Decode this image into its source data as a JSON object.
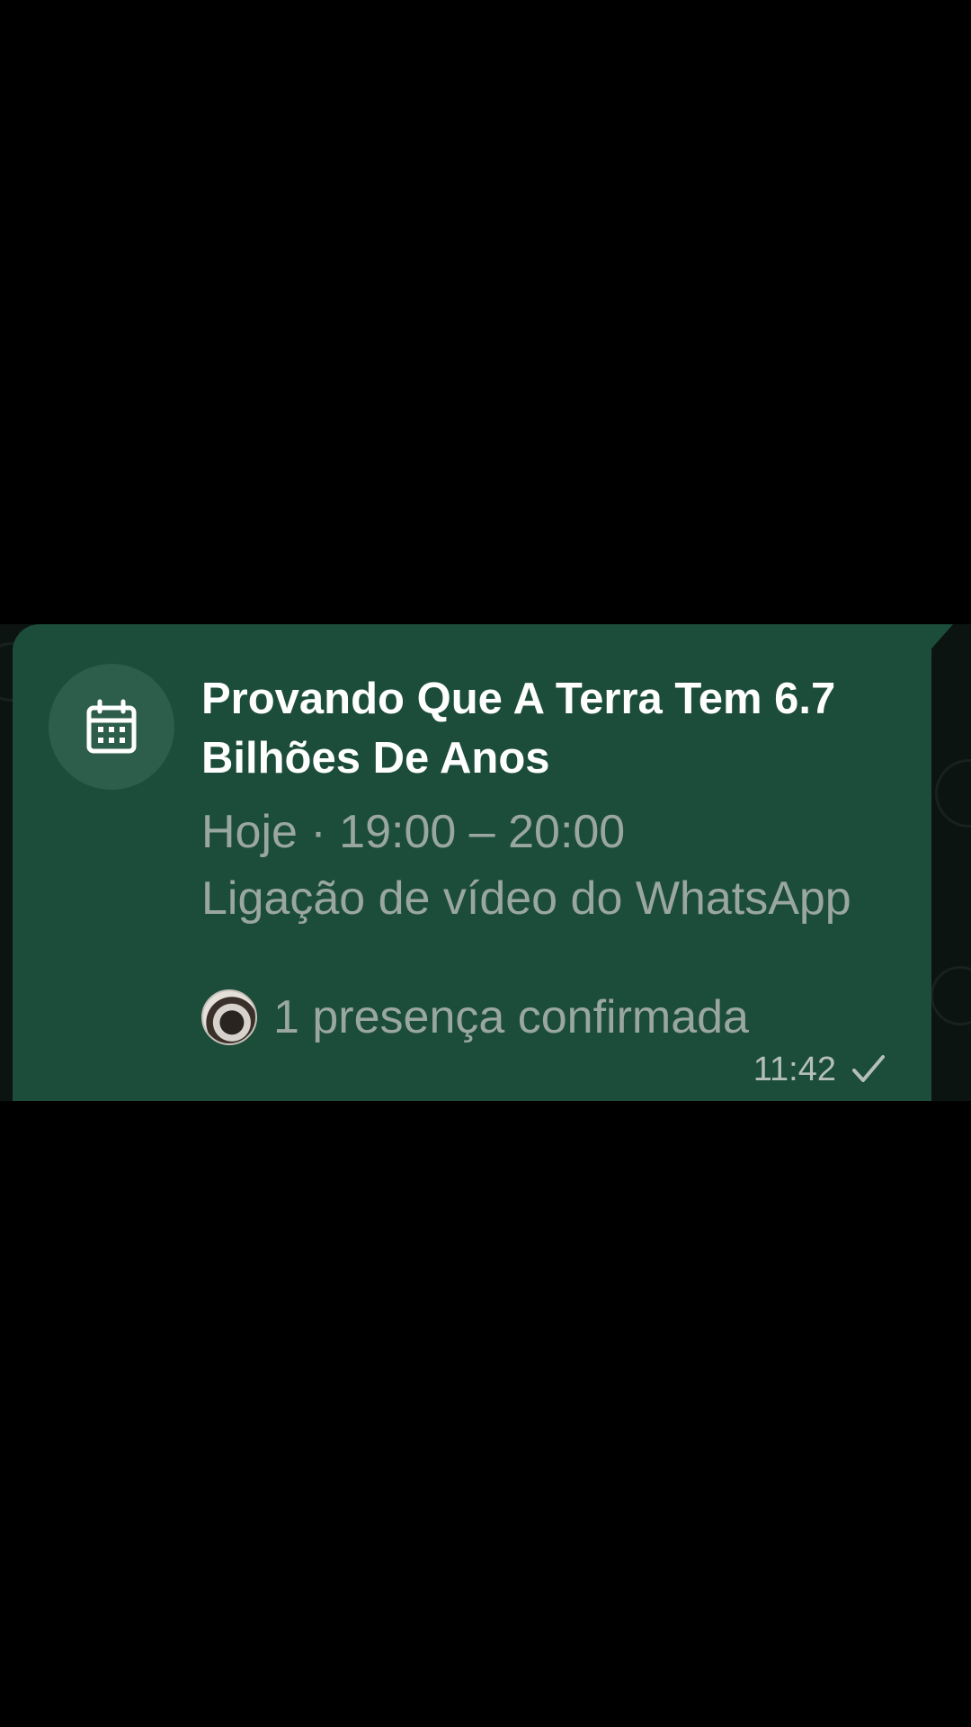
{
  "event": {
    "title": "Provando Que A Terra Tem 6.7 Bilhões De Anos",
    "time": "Hoje · 19:00 – 20:00",
    "location": "Ligação de vídeo do WhatsApp",
    "rsvp": "1 presença confirmada",
    "icon": "calendar-icon"
  },
  "message": {
    "timestamp": "11:42",
    "status_icon": "single-check-icon"
  },
  "colors": {
    "bubble": "#1c4d3a",
    "background": "#000000",
    "title": "#ffffff",
    "secondary_text": "#9aa7a1"
  }
}
